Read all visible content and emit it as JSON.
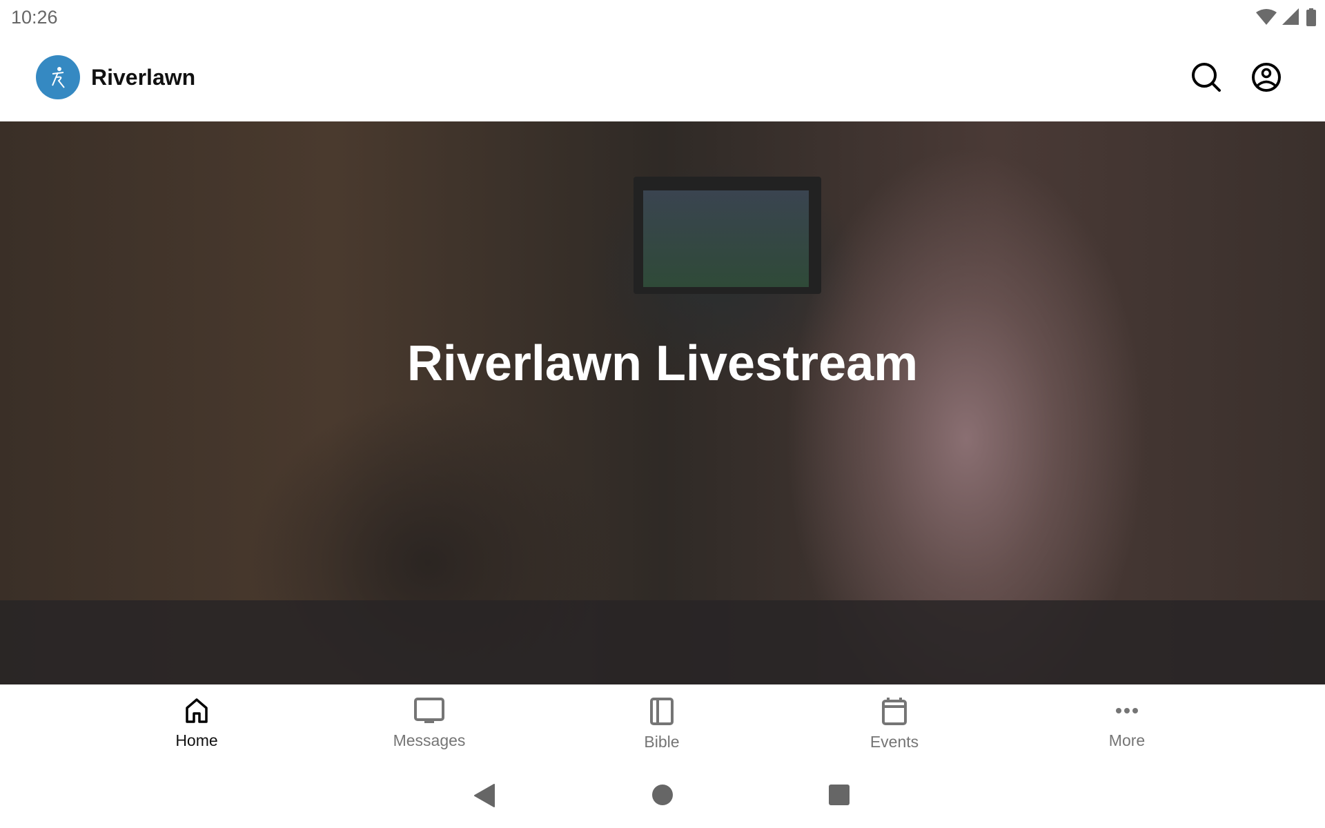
{
  "status_bar": {
    "time": "10:26",
    "icons": [
      "wifi-icon",
      "signal-icon",
      "battery-icon"
    ]
  },
  "header": {
    "title": "Riverlawn",
    "logo_color": "#3589c2",
    "actions": [
      "search-icon",
      "account-icon"
    ]
  },
  "hero": {
    "title": "Riverlawn Livestream"
  },
  "bottom_nav": {
    "active": "Home",
    "items": [
      {
        "label": "Home",
        "icon": "home-icon"
      },
      {
        "label": "Messages",
        "icon": "monitor-icon"
      },
      {
        "label": "Bible",
        "icon": "book-icon"
      },
      {
        "label": "Events",
        "icon": "calendar-icon"
      },
      {
        "label": "More",
        "icon": "more-icon"
      }
    ]
  },
  "system_nav": [
    "back",
    "home",
    "recents"
  ]
}
